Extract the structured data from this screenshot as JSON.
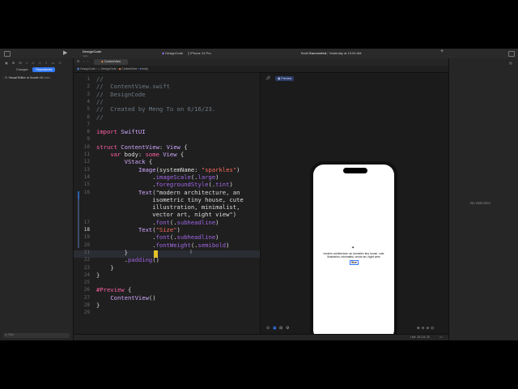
{
  "toolbar": {
    "project": "DesignCode",
    "branch": "main",
    "scheme_project": "DesignCode",
    "device": "iPhone 14 Pro",
    "status_prefix": "Build",
    "status_bold": "Succeeded",
    "status_time": "Yesterday at 10:54 AM"
  },
  "navigator": {
    "segments": [
      "Changes",
      "Repositories"
    ],
    "selected_segment": "Repositories",
    "item": "2. Visual Editor in Xcode 15",
    "item_badge": "main",
    "filter_placeholder": "Filter"
  },
  "editor": {
    "tab": "ContentView",
    "jump_bar": [
      "DesignCode",
      "DesignCode",
      "ContentView",
      "body"
    ],
    "current_line": 18,
    "lines": [
      {
        "n": "1",
        "t": "//"
      },
      {
        "n": "2",
        "t": "//  ContentView.swift"
      },
      {
        "n": "3",
        "t": "//  DesignCode"
      },
      {
        "n": "4",
        "t": "//"
      },
      {
        "n": "5",
        "t": "//  Created by Meng To on 6/16/23."
      },
      {
        "n": "6",
        "t": "//"
      },
      {
        "n": "7",
        "t": ""
      },
      {
        "n": "8",
        "t": "import SwiftUI"
      },
      {
        "n": "9",
        "t": ""
      },
      {
        "n": "10",
        "t": "struct ContentView: View {"
      },
      {
        "n": "11",
        "t": "    var body: some View {"
      },
      {
        "n": "12",
        "t": "        VStack {"
      },
      {
        "n": "13",
        "t": "            Image(systemName: \"sparkles\")"
      },
      {
        "n": "14",
        "t": "                .imageScale(.large)"
      },
      {
        "n": "15",
        "t": "                .foregroundStyle(.tint)"
      },
      {
        "n": "16",
        "t": "            Text(\"modern architecture, an"
      },
      {
        "n": "",
        "t": "                isometric tiny house, cute"
      },
      {
        "n": "",
        "t": "                illustration, minimalist,"
      },
      {
        "n": "",
        "t": "                vector art, night view\")"
      },
      {
        "n": "17",
        "t": "                .font(.subheadline)"
      },
      {
        "n": "18",
        "t": "            Text(\"Size\")"
      },
      {
        "n": "19",
        "t": "                .font(.subheadline)"
      },
      {
        "n": "20",
        "t": "                .fontWeight(.semibold)"
      },
      {
        "n": "21",
        "t": "        }"
      },
      {
        "n": "22",
        "t": "        .padding()"
      },
      {
        "n": "23",
        "t": "    }"
      },
      {
        "n": "24",
        "t": "}"
      },
      {
        "n": "25",
        "t": ""
      },
      {
        "n": "26",
        "t": "#Preview {"
      },
      {
        "n": "27",
        "t": "    ContentView()"
      },
      {
        "n": "28",
        "t": "}"
      },
      {
        "n": "29",
        "t": ""
      }
    ]
  },
  "canvas": {
    "preview_label": "Preview",
    "device_mode": "Automatic",
    "device": "iPhone 14 Pro",
    "preview_text": "modern architecture, an isometric tiny house, cute illustration, minimalist, vector art, night view",
    "preview_size": "Size"
  },
  "status": {
    "position": "Line: 18  Col: 20"
  },
  "inspector": {
    "empty": "No Selection"
  },
  "colors": {
    "accent": "#3478f6",
    "background": "#1e1e1e"
  }
}
